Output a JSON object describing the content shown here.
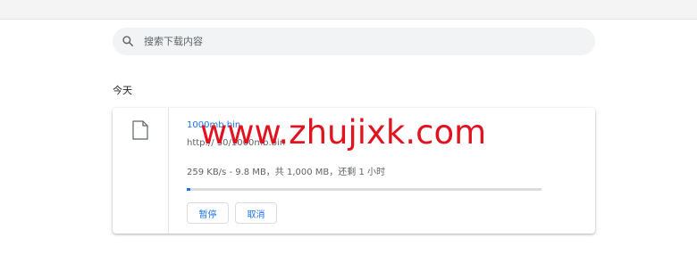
{
  "search": {
    "placeholder": "搜索下载内容",
    "icon": "search-icon"
  },
  "section": {
    "date_label": "今天"
  },
  "download": {
    "file_name": "1000mb.bin",
    "url": "http://  30/1000mb.bin",
    "status": "259 KB/s - 9.8 MB，共 1,000 MB，还剩 1 小时",
    "progress": 0.0098,
    "pause_label": "暂停",
    "cancel_label": "取消",
    "icon": "file-icon"
  },
  "watermark": {
    "text": "www.zhujixk.com",
    "color": "#e0131f"
  },
  "colors": {
    "accent": "#1a73e8",
    "topbar": "#f4f4f5",
    "search_bg": "#f1f3f4"
  }
}
